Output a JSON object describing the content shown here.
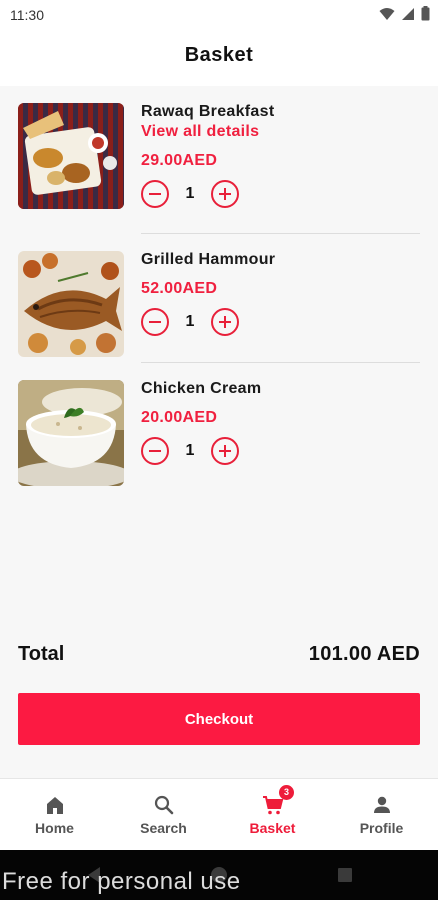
{
  "status_bar": {
    "time": "11:30",
    "icons": [
      "wifi-icon",
      "signal-icon",
      "battery-icon"
    ]
  },
  "header": {
    "title": "Basket"
  },
  "items": [
    {
      "name": "Rawaq Breakfast",
      "link": "View all details",
      "price": "29.00AED",
      "qty": "1",
      "image": "breakfast-platter"
    },
    {
      "name": "Grilled Hammour",
      "price": "52.00AED",
      "qty": "1",
      "image": "grilled-fish"
    },
    {
      "name": "Chicken Cream",
      "price": "20.00AED",
      "qty": "1",
      "image": "soup-bowl"
    }
  ],
  "total": {
    "label": "Total",
    "value": "101.00 AED"
  },
  "checkout": {
    "label": "Checkout"
  },
  "bottom_nav": {
    "items": [
      {
        "label": "Home",
        "icon": "home-icon"
      },
      {
        "label": "Search",
        "icon": "search-icon"
      },
      {
        "label": "Basket",
        "icon": "cart-icon",
        "badge": "3",
        "active": true
      },
      {
        "label": "Profile",
        "icon": "person-icon"
      }
    ]
  },
  "watermark": "Free for personal use",
  "colors": {
    "accent": "#f0203f",
    "button": "#fc1a42",
    "background": "#f7f7f7"
  }
}
